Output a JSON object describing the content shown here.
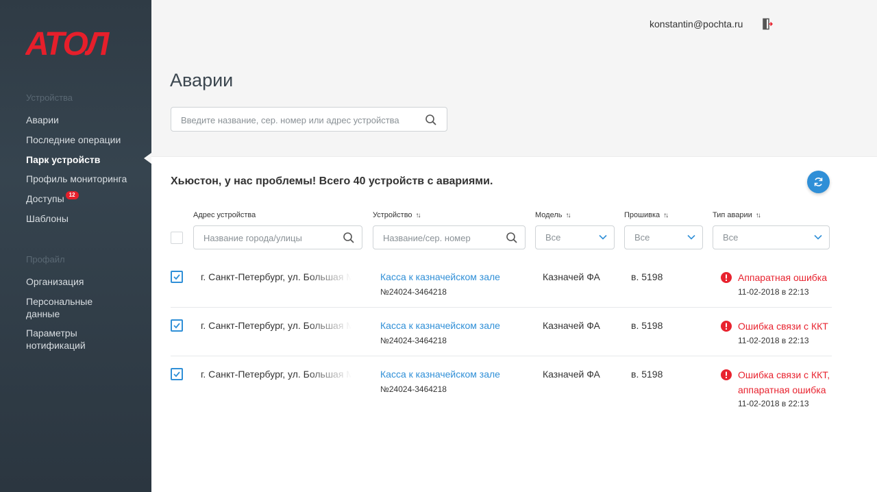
{
  "brand": {
    "logo_text": "АТОЛ",
    "logo_color": "#e61f2b"
  },
  "sidebar": {
    "section_devices": "Устройства",
    "items_devices": [
      {
        "label": "Аварии"
      },
      {
        "label": "Последние операции"
      },
      {
        "label": "Парк устройств",
        "active": true
      },
      {
        "label": "Профиль мониторинга"
      },
      {
        "label": "Доступы",
        "badge": "12"
      },
      {
        "label": "Шаблоны"
      }
    ],
    "section_profile": "Профайл",
    "items_profile": [
      {
        "label": "Организация"
      },
      {
        "label_line1": "Персональные",
        "label_line2": "данные"
      },
      {
        "label_line1": "Параметры",
        "label_line2": "нотификаций"
      }
    ]
  },
  "header": {
    "user_email": "konstantin@pochta.ru",
    "page_title": "Аварии",
    "search_placeholder": "Введите название, сер. номер или адрес устройства"
  },
  "main": {
    "summary": "Хьюстон, у нас проблемы! Всего 40 устройств с авариями.",
    "columns": {
      "address": {
        "label": "Адрес устройства",
        "placeholder": "Название города/улицы"
      },
      "device": {
        "label": "Устройство",
        "placeholder": "Название/сер. номер"
      },
      "model": {
        "label": "Модель",
        "value": "Все"
      },
      "firmware": {
        "label": "Прошивка",
        "value": "Все"
      },
      "alert_type": {
        "label": "Тип аварии",
        "value": "Все"
      }
    },
    "rows": [
      {
        "address": "г. Санкт-Петербург, ул. Большая Морская",
        "device": "Касса к казначейском зале",
        "serial": "№24024-3464218",
        "model": "Казначей ФА",
        "firmware": "в. 5198",
        "alert_line1": "Аппаратная ошибка",
        "alert_line2": "",
        "time": "11-02-2018 в 22:13",
        "checked": true
      },
      {
        "address": "г. Санкт-Петербург, ул. Большая Морская",
        "device": "Касса к казначейском зале",
        "serial": "№24024-3464218",
        "model": "Казначей ФА",
        "firmware": "в. 5198",
        "alert_line1": "Ошибка связи с ККТ",
        "alert_line2": "",
        "time": "11-02-2018 в 22:13",
        "checked": true
      },
      {
        "address": "г. Санкт-Петербург, ул. Большая Морская",
        "device": "Касса к казначейском зале",
        "serial": "№24024-3464218",
        "model": "Казначей ФА",
        "firmware": "в. 5198",
        "alert_line1": "Ошибка связи с ККТ,",
        "alert_line2": "аппаратная ошибка",
        "time": "11-02-2018 в 22:13",
        "checked": true
      }
    ]
  },
  "colors": {
    "accent": "#2f8fd7",
    "alert": "#e8232f",
    "sidebar_bg": "#323f4a"
  }
}
